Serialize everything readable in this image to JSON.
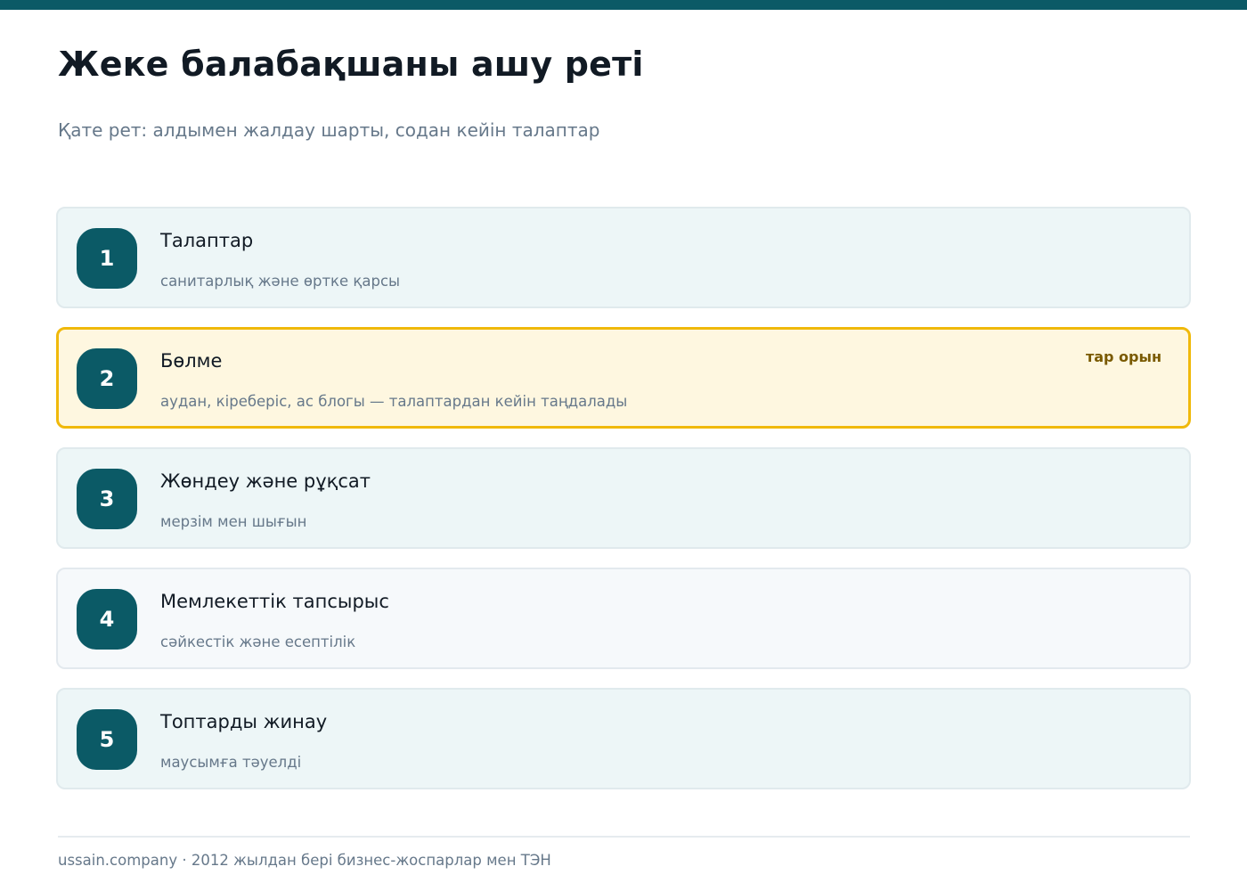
{
  "page": {
    "title": "Жеке балабақшаны ашу реті",
    "subtitle": "Қате рет: алдымен жалдау шарты, содан кейін талаптар"
  },
  "steps": [
    {
      "number": "1",
      "title": "Талаптар",
      "description": "санитарлық және өртке қарсы"
    },
    {
      "number": "2",
      "title": "Бөлме",
      "description": "аудан, кіреберіс, ас блогы — талаптардан кейін таңдалады",
      "tag": "тар орын"
    },
    {
      "number": "3",
      "title": "Жөндеу және рұқсат",
      "description": "мерзім мен шығын"
    },
    {
      "number": "4",
      "title": "Мемлекеттік тапсырыс",
      "description": "сәйкестік және есептілік"
    },
    {
      "number": "5",
      "title": "Топтарды жинау",
      "description": "маусымға тәуелді"
    }
  ],
  "footer": {
    "text": "ussain.company · 2012 жылдан бері бизнес-жоспарлар мен ТЭН"
  },
  "colors": {
    "accent": "#0b5a66",
    "highlight_border": "#f0b90b",
    "highlight_background": "#fef7e0"
  }
}
